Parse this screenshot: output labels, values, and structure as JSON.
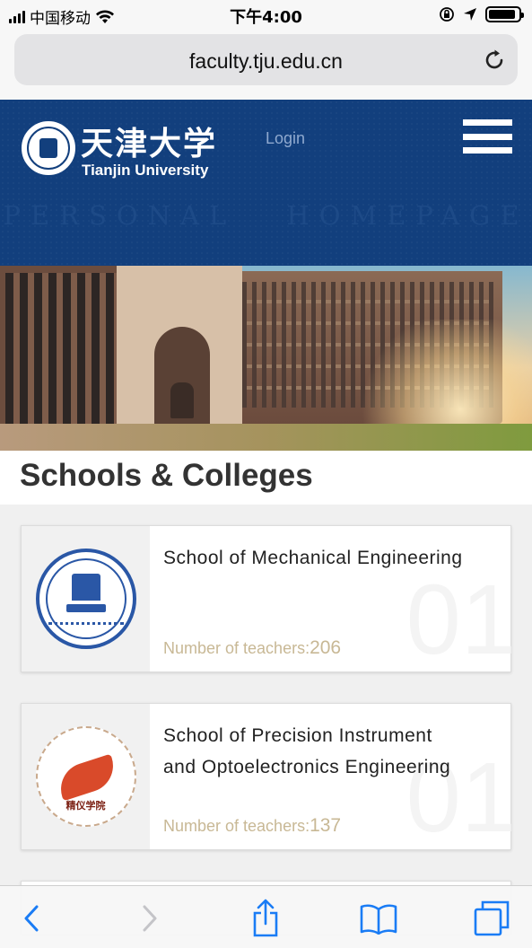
{
  "status_bar": {
    "carrier": "中国移动",
    "time": "下午4:00",
    "battery_percent": 90
  },
  "browser": {
    "url": "faculty.tju.edu.cn",
    "reload_icon": "reload-icon"
  },
  "site_header": {
    "brand_cn": "天津大学",
    "brand_en": "Tianjin University",
    "login_label": "Login",
    "banner_text": "PERSONAL HOMEPAGE",
    "menu_icon": "hamburger-menu-icon"
  },
  "section": {
    "title": "Schools & Colleges"
  },
  "schools": [
    {
      "name": "School of Mechanical Engineering",
      "count_label": "Number of teachers:",
      "count": "206",
      "index": "01"
    },
    {
      "name": "School of Precision Instrument and Optoelectronics Engineering",
      "count_label": "Number of teachers:",
      "count": "137",
      "index": "01"
    }
  ],
  "logo_texts": {
    "precision": "精仪学院"
  },
  "toolbar": {
    "back_icon": "back-chevron-icon",
    "forward_icon": "forward-chevron-icon",
    "share_icon": "share-icon",
    "bookmarks_icon": "bookmarks-icon",
    "tabs_icon": "tabs-icon"
  },
  "colors": {
    "header_blue": "#123f7d",
    "count_gold": "#c8b895",
    "ios_blue": "#1a7cf5"
  }
}
